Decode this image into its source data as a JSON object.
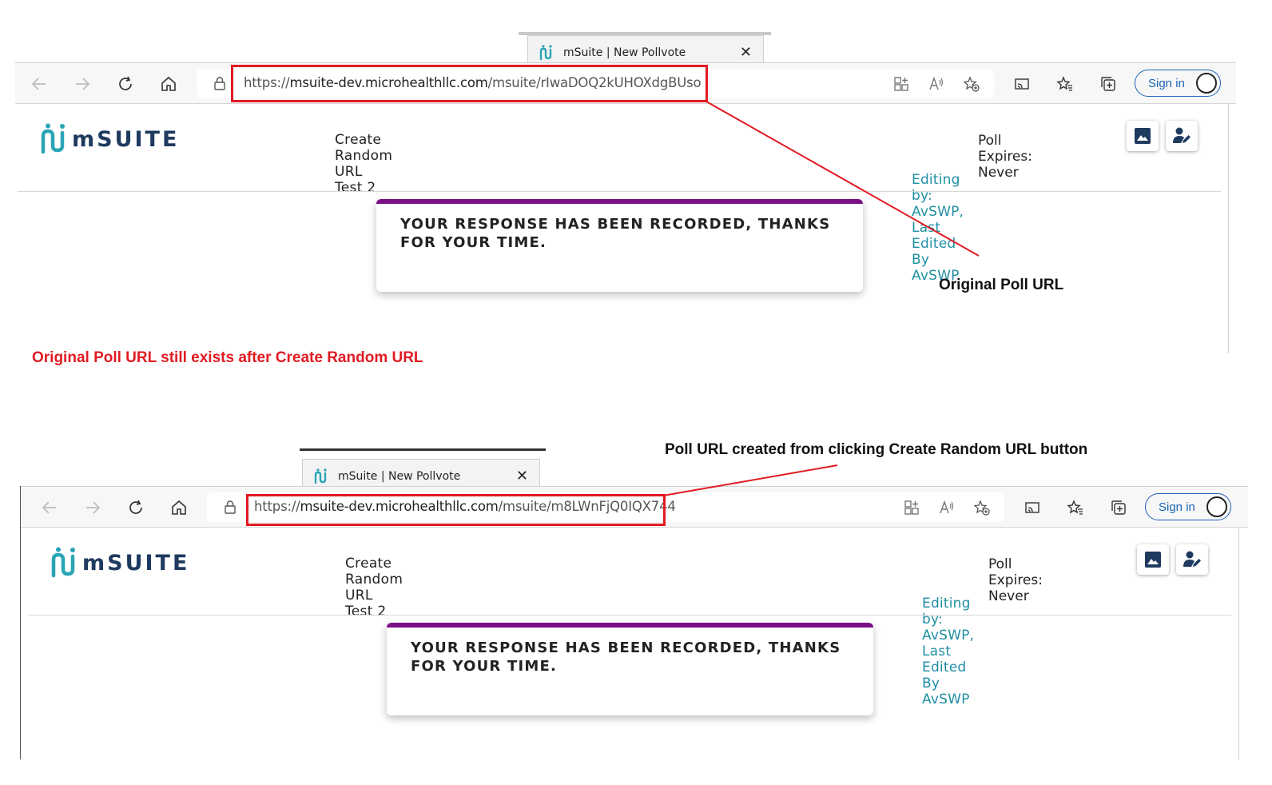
{
  "annotations": {
    "original_poll_url": "Original Poll URL",
    "still_exists_note": "Original Poll URL still exists after Create Random URL",
    "random_url_note": "Poll URL created from clicking Create Random URL button"
  },
  "screenshots": [
    {
      "tab_title": "mSuite | New Pollvote",
      "url_scheme": "https://",
      "url_host": "msuite-dev.microhealthllc.com",
      "url_path": "/msuite/rIwaDOQ2kUHOXdgBUso",
      "sign_in_label": "Sign in",
      "logo_text": "mSUITE",
      "poll_title": "Create Random URL Test 2",
      "poll_expires": "Poll Expires: Never",
      "editing_info": "Editing by: AvSWP,  Last Edited By AvSWP",
      "response_message": "YOUR RESPONSE HAS BEEN RECORDED, THANKS FOR YOUR TIME."
    },
    {
      "tab_title": "mSuite | New Pollvote",
      "url_scheme": "https://",
      "url_host": "msuite-dev.microhealthllc.com",
      "url_path": "/msuite/m8LWnFjQ0IQX744",
      "sign_in_label": "Sign in",
      "logo_text": "mSUITE",
      "poll_title": "Create Random URL Test 2",
      "poll_expires": "Poll Expires: Never",
      "editing_info": "Editing by: AvSWP,  Last Edited By AvSWP",
      "response_message": "YOUR RESPONSE HAS BEEN RECORDED, THANKS FOR YOUR TIME."
    }
  ],
  "colors": {
    "annotation_red": "#e11b22",
    "card_accent": "#7a0f86",
    "editing_teal": "#1f8fa3",
    "sign_in_blue": "#1b63b7"
  }
}
